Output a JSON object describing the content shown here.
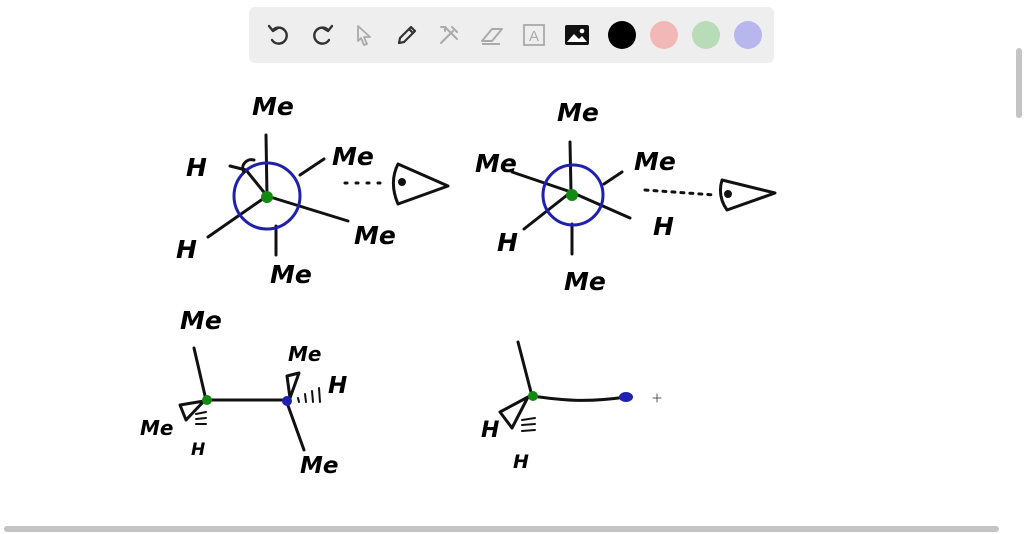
{
  "toolbar": {
    "tools": [
      "undo-icon",
      "redo-icon",
      "select-pointer-icon",
      "pen-icon",
      "tools-icon",
      "eraser-icon",
      "text-icon",
      "image-icon"
    ],
    "text_tool_glyph": "A",
    "colors": [
      "#000000",
      "#f2b7b7",
      "#b7dcb7",
      "#b7b7ee"
    ]
  },
  "labels": {
    "me": "Me",
    "h": "H"
  },
  "colors": {
    "ink": "#111111",
    "blue": "#1f1fb0",
    "green": "#128a12"
  }
}
